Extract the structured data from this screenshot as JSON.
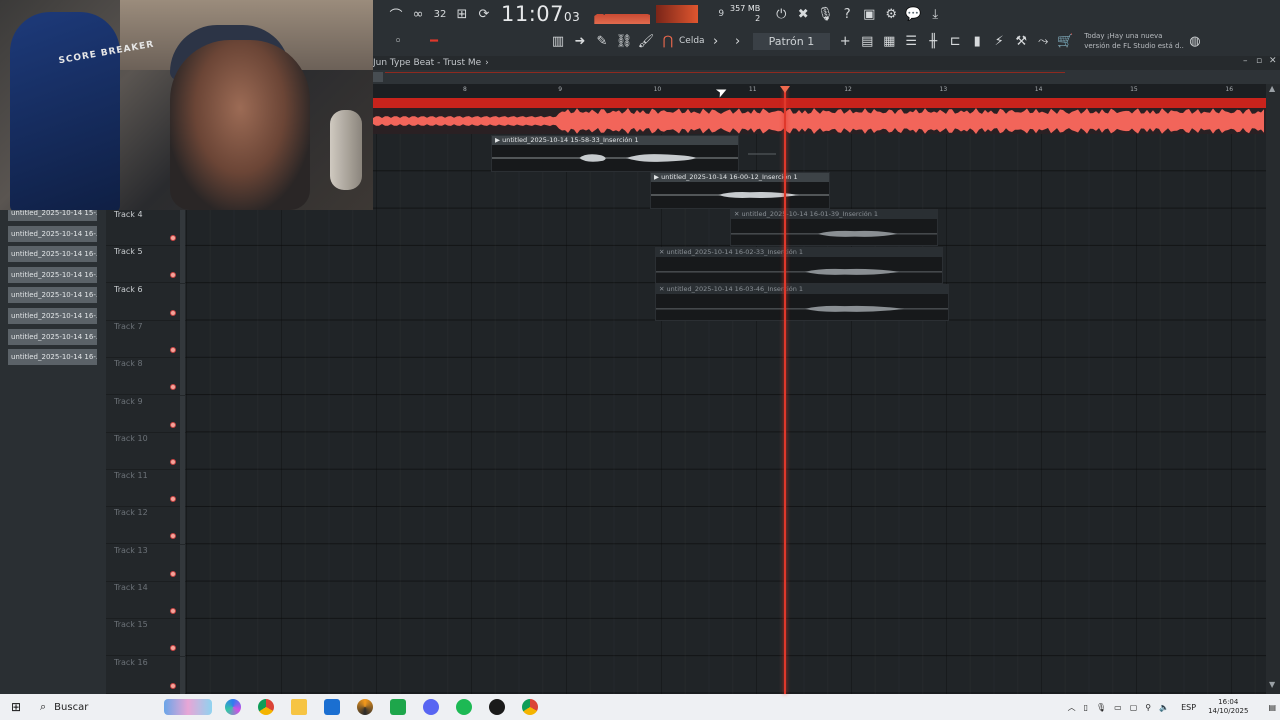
{
  "toolbar": {
    "time_main": "11:07",
    "time_small": "03",
    "cpu_value": "9",
    "memory_mb": "357 MB",
    "memory_count": "2",
    "snap_label": "Celda",
    "pattern_label": "Patrón 1",
    "news_title": "Today",
    "news_text_1": "¡Hay una nueva",
    "news_text_2": "versión de FL Studio está d..",
    "time_sig": "32"
  },
  "playlist": {
    "title": "Jun Type Beat - Trust Me",
    "title_arrow": "›",
    "ruler_ticks": [
      "8",
      "9",
      "10",
      "11",
      "12",
      "13",
      "14",
      "15",
      "16"
    ]
  },
  "picker": {
    "items": [
      "untitled_2025-10-14 15-...",
      "untitled_2025-10-14 16-...",
      "untitled_2025-10-14 16-...",
      "untitled_2025-10-14 16-...",
      "untitled_2025-10-14 16-...",
      "untitled_2025-10-14 16-...",
      "untitled_2025-10-14 16-...",
      "untitled_2025-10-14 16-..."
    ]
  },
  "tracks": [
    "Track 4",
    "Track 5",
    "Track 6",
    "Track 7",
    "Track 8",
    "Track 9",
    "Track 10",
    "Track 11",
    "Track 12",
    "Track 13",
    "Track 14",
    "Track 15",
    "Track 16"
  ],
  "clips": {
    "c1": "untitled_2025-10-14 15-58-33_Inserción 1",
    "c2": "untitled_2025-10-14 16-00-12_Inserción 1",
    "c3": "untitled_2025-10-14 16-01-39_Inserción 1",
    "c4": "untitled_2025-10-14 16-02-33_Inserción 1",
    "c5": "untitled_2025-10-14 16-03-46_Inserción 1"
  },
  "webcam": {
    "chair_text": "SCORE BREAKER"
  },
  "taskbar": {
    "search_label": "Buscar",
    "lang": "ESP",
    "time": "16:04",
    "date": "14/10/2025"
  },
  "colors": {
    "accent": "#e0382b",
    "master_band": "#c8231c",
    "waveform": "#f2655a"
  }
}
